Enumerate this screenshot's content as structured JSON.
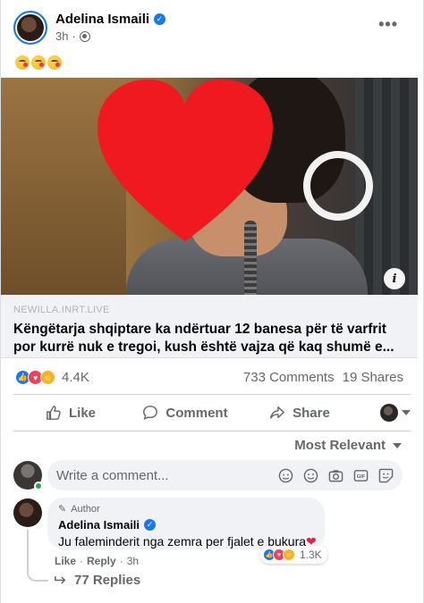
{
  "post": {
    "author": "Adelina Ismaili",
    "time": "3h",
    "dot": "·",
    "more_glyph": "•••",
    "emoji_text": ""
  },
  "link": {
    "domain": "NEWILLA.INRT.LIVE",
    "title_line1": "Këngëtarja shqiptare ka ndërtuar 12 banesa për të varfrit",
    "title_line2": "por kurrë nuk e tregoi, kush është vajza që kaq shumë e..."
  },
  "stats": {
    "reactions": "4.4K",
    "comments": "733 Comments",
    "shares": "19 Shares"
  },
  "actions": {
    "like": "Like",
    "comment": "Comment",
    "share": "Share"
  },
  "sort": {
    "label": "Most Relevant"
  },
  "composer": {
    "placeholder": "Write a comment..."
  },
  "comment": {
    "author_badge": "Author",
    "name": "Adelina Ismaili",
    "text": "Ju faleminderit nga zemra per fjalet e bukura",
    "heart": "❤",
    "reactions": "1.3K",
    "like": "Like",
    "reply": "Reply",
    "sep": "·",
    "time": "3h",
    "replies": "77 Replies"
  },
  "colors": {
    "accent": "#1877f2",
    "heart_overlay": "#f0191f",
    "text_secondary": "#65676b"
  },
  "icons": [
    "globe-icon",
    "more-icon",
    "info-icon",
    "like-icon",
    "comment-icon",
    "share-icon",
    "chevron-down-icon",
    "sticker-icon",
    "emoji-icon",
    "camera-icon",
    "gif-icon",
    "reply-arrow-icon"
  ]
}
